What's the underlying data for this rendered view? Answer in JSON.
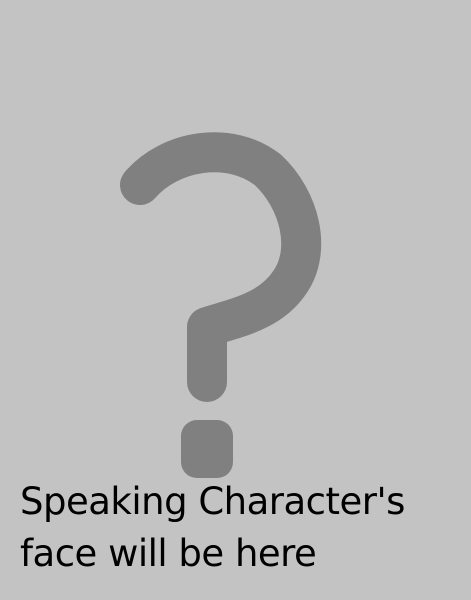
{
  "placeholder": {
    "icon": "question-mark-icon",
    "background_color": "#c3c3c3",
    "icon_color": "#808080",
    "text_color": "#000000",
    "caption_line_1": "Speaking Character's",
    "caption_line_2": "face will be here"
  }
}
